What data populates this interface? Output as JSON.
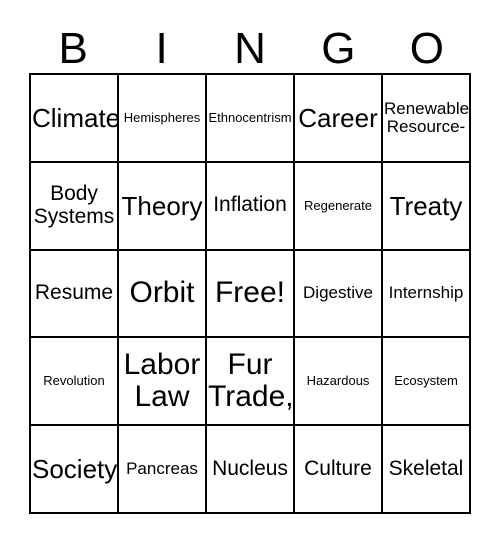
{
  "header": {
    "letters": [
      "B",
      "I",
      "N",
      "G",
      "O"
    ]
  },
  "grid": {
    "rows": [
      [
        {
          "text": "Climate",
          "size": "fs-lg"
        },
        {
          "text": "Hemispheres",
          "size": "fs-xs"
        },
        {
          "text": "Ethnocentrism",
          "size": "fs-xs"
        },
        {
          "text": "Career",
          "size": "fs-lg"
        },
        {
          "text": "Renewable\nResource-",
          "size": "fs-sm"
        }
      ],
      [
        {
          "text": "Body\nSystems",
          "size": "fs-md"
        },
        {
          "text": "Theory",
          "size": "fs-lg"
        },
        {
          "text": "Inflation",
          "size": "fs-md"
        },
        {
          "text": "Regenerate",
          "size": "fs-xs"
        },
        {
          "text": "Treaty",
          "size": "fs-lg"
        }
      ],
      [
        {
          "text": "Resume",
          "size": "fs-md"
        },
        {
          "text": "Orbit",
          "size": "fs-xl"
        },
        {
          "text": "Free!",
          "size": "fs-xl"
        },
        {
          "text": "Digestive",
          "size": "fs-sm"
        },
        {
          "text": "Internship",
          "size": "fs-sm"
        }
      ],
      [
        {
          "text": "Revolution",
          "size": "fs-xs"
        },
        {
          "text": "Labor\nLaw",
          "size": "fs-xl"
        },
        {
          "text": "Fur\nTrade,",
          "size": "fs-xl"
        },
        {
          "text": "Hazardous",
          "size": "fs-xs"
        },
        {
          "text": "Ecosystem",
          "size": "fs-xs"
        }
      ],
      [
        {
          "text": "Society",
          "size": "fs-lg"
        },
        {
          "text": "Pancreas",
          "size": "fs-sm"
        },
        {
          "text": "Nucleus",
          "size": "fs-md"
        },
        {
          "text": "Culture",
          "size": "fs-md"
        },
        {
          "text": "Skeletal",
          "size": "fs-md"
        }
      ]
    ]
  },
  "colors": {
    "border": "#000000",
    "background": "#ffffff",
    "text": "#000000"
  }
}
